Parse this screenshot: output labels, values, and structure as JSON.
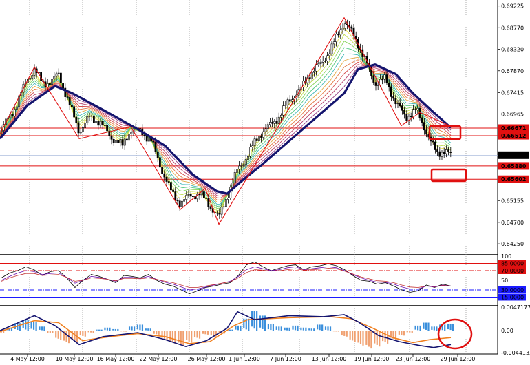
{
  "chart_data": [
    {
      "type": "candlestick",
      "panel": "price",
      "y_ticks": [
        "0.69225",
        "0.68770",
        "0.68320",
        "0.67870",
        "0.67415",
        "0.66965",
        "0.66512",
        "0.66105",
        "0.65580",
        "0.65155",
        "0.64700",
        "0.64250"
      ],
      "y_range": [
        0.6405,
        0.6935
      ],
      "price_tags": [
        {
          "label": "0.66671",
          "value": 0.66671,
          "color": "#e01010"
        },
        {
          "label": "0.66512",
          "value": 0.66512,
          "color": "#e01010"
        },
        {
          "label": "0.66105",
          "value": 0.66105,
          "color": "#000000"
        },
        {
          "label": "0.65880",
          "value": 0.6588,
          "color": "#e01010"
        },
        {
          "label": "0.65602",
          "value": 0.65602,
          "color": "#e01010"
        }
      ],
      "horizontal_lines": [
        0.66671,
        0.66512,
        0.6588,
        0.65602
      ],
      "zigzag": [
        [
          0,
          0.6655
        ],
        [
          50,
          0.6795
        ],
        [
          115,
          0.6645
        ],
        [
          190,
          0.667
        ],
        [
          262,
          0.6497
        ],
        [
          298,
          0.6541
        ],
        [
          318,
          0.6466
        ],
        [
          500,
          0.6898
        ],
        [
          583,
          0.6672
        ],
        [
          610,
          0.67
        ],
        [
          655,
          0.6671
        ]
      ],
      "close_path": [
        [
          0,
          0.666
        ],
        [
          20,
          0.6705
        ],
        [
          40,
          0.677
        ],
        [
          50,
          0.679
        ],
        [
          62,
          0.676
        ],
        [
          75,
          0.6765
        ],
        [
          85,
          0.678
        ],
        [
          95,
          0.674
        ],
        [
          105,
          0.67
        ],
        [
          115,
          0.666
        ],
        [
          130,
          0.669
        ],
        [
          145,
          0.668
        ],
        [
          160,
          0.665
        ],
        [
          178,
          0.663
        ],
        [
          190,
          0.6665
        ],
        [
          205,
          0.666
        ],
        [
          220,
          0.664
        ],
        [
          235,
          0.658
        ],
        [
          250,
          0.653
        ],
        [
          262,
          0.651
        ],
        [
          275,
          0.6525
        ],
        [
          290,
          0.653
        ],
        [
          305,
          0.6505
        ],
        [
          318,
          0.648
        ],
        [
          330,
          0.6525
        ],
        [
          345,
          0.658
        ],
        [
          360,
          0.661
        ],
        [
          375,
          0.665
        ],
        [
          390,
          0.667
        ],
        [
          405,
          0.669
        ],
        [
          420,
          0.6725
        ],
        [
          435,
          0.6745
        ],
        [
          450,
          0.678
        ],
        [
          465,
          0.68
        ],
        [
          480,
          0.683
        ],
        [
          500,
          0.689
        ],
        [
          510,
          0.687
        ],
        [
          520,
          0.6845
        ],
        [
          530,
          0.681
        ],
        [
          545,
          0.676
        ],
        [
          560,
          0.677
        ],
        [
          575,
          0.672
        ],
        [
          590,
          0.669
        ],
        [
          605,
          0.6705
        ],
        [
          615,
          0.6675
        ],
        [
          625,
          0.664
        ],
        [
          635,
          0.6615
        ],
        [
          645,
          0.662
        ],
        [
          655,
          0.661
        ]
      ],
      "ma_thick": [
        [
          0,
          0.6645
        ],
        [
          40,
          0.6715
        ],
        [
          80,
          0.6755
        ],
        [
          105,
          0.674
        ],
        [
          150,
          0.6705
        ],
        [
          200,
          0.6665
        ],
        [
          240,
          0.663
        ],
        [
          280,
          0.657
        ],
        [
          315,
          0.6535
        ],
        [
          330,
          0.653
        ],
        [
          350,
          0.6555
        ],
        [
          380,
          0.659
        ],
        [
          420,
          0.664
        ],
        [
          460,
          0.669
        ],
        [
          500,
          0.674
        ],
        [
          520,
          0.679
        ],
        [
          545,
          0.68
        ],
        [
          575,
          0.678
        ],
        [
          600,
          0.674
        ],
        [
          630,
          0.67
        ],
        [
          655,
          0.6668
        ]
      ],
      "x_ticks": [
        "4 May 12:00",
        "10 May 12:00",
        "16 May 12:00",
        "22 May 12:00",
        "26 May 12:00",
        "1 Jun 12:00",
        "7 Jun 12:00",
        "13 Jun 12:00",
        "19 Jun 12:00",
        "23 Jun 12:00",
        "29 Jun 12:00"
      ]
    },
    {
      "type": "line",
      "panel": "oscillator",
      "y_ticks": [
        "100",
        "85.0000",
        "70.0000",
        "50",
        "30.0000",
        "15.0000"
      ],
      "y_range": [
        0,
        100
      ],
      "levels": [
        {
          "value": 85,
          "color": "#e01010",
          "style": "solid"
        },
        {
          "value": 70,
          "color": "#e01010",
          "style": "dashdot"
        },
        {
          "value": 30,
          "color": "#1a1aff",
          "style": "dashdot"
        },
        {
          "value": 15,
          "color": "#1a1aff",
          "style": "solid"
        }
      ],
      "series": [
        {
          "color": "#000000",
          "values": [
            55,
            65,
            70,
            78,
            72,
            60,
            68,
            70,
            55,
            35,
            50,
            62,
            58,
            52,
            45,
            60,
            58,
            55,
            62,
            50,
            42,
            38,
            30,
            22,
            28,
            35,
            38,
            42,
            45,
            60,
            82,
            88,
            78,
            70,
            75,
            80,
            82,
            72,
            78,
            80,
            84,
            80,
            72,
            60,
            50,
            48,
            42,
            45,
            38,
            30,
            25,
            28,
            40,
            35,
            42,
            38
          ]
        },
        {
          "color": "#6a0dad",
          "values": [
            50,
            58,
            65,
            70,
            68,
            62,
            64,
            65,
            56,
            44,
            50,
            58,
            56,
            52,
            48,
            56,
            56,
            54,
            58,
            52,
            46,
            42,
            36,
            30,
            32,
            36,
            40,
            44,
            48,
            58,
            72,
            78,
            74,
            70,
            72,
            76,
            78,
            72,
            74,
            76,
            78,
            76,
            70,
            62,
            55,
            50,
            46,
            46,
            42,
            36,
            32,
            32,
            38,
            36,
            40,
            38
          ]
        },
        {
          "color": "#c03030",
          "values": [
            48,
            55,
            60,
            64,
            64,
            60,
            61,
            62,
            56,
            48,
            50,
            55,
            54,
            52,
            49,
            54,
            54,
            53,
            55,
            52,
            48,
            45,
            40,
            35,
            35,
            38,
            41,
            44,
            47,
            55,
            66,
            72,
            71,
            69,
            70,
            72,
            74,
            71,
            72,
            73,
            75,
            74,
            69,
            63,
            57,
            53,
            49,
            48,
            45,
            40,
            36,
            35,
            38,
            37,
            39,
            38
          ]
        }
      ]
    },
    {
      "type": "bar",
      "panel": "macd",
      "y_ticks": [
        "0.0047177",
        "0.00",
        "-0.0044133"
      ],
      "y_range": [
        -0.0044133,
        0.0047177
      ],
      "histogram": [
        -0.0005,
        0.0005,
        0.0015,
        0.0022,
        0.0018,
        0.0008,
        -0.0005,
        -0.0018,
        -0.0025,
        -0.0022,
        -0.0012,
        -0.0004,
        0.0002,
        0.0006,
        0.0003,
        -0.0002,
        0.0008,
        0.0012,
        0.0004,
        -0.0008,
        -0.0018,
        -0.0026,
        -0.003,
        -0.0024,
        -0.0016,
        -0.0008,
        -0.0012,
        -0.0006,
        0.0002,
        0.001,
        0.0024,
        0.004,
        0.003,
        0.0014,
        0.0008,
        0.0006,
        0.001,
        0.0006,
        0.0004,
        0.0012,
        0.0008,
        -0.0002,
        -0.0012,
        -0.0022,
        -0.003,
        -0.0036,
        -0.0032,
        -0.0026,
        -0.0018,
        -0.001,
        -0.0004,
        0.001,
        0.0016,
        0.0008,
        0.0012,
        0.0014
      ],
      "macd_line": [
        [
          0,
          0.0
        ],
        [
          50,
          0.003
        ],
        [
          80,
          0.001
        ],
        [
          115,
          -0.0028
        ],
        [
          150,
          -0.0012
        ],
        [
          200,
          -0.0004
        ],
        [
          240,
          -0.0018
        ],
        [
          270,
          -0.0032
        ],
        [
          300,
          -0.002
        ],
        [
          330,
          0.0005
        ],
        [
          345,
          0.0038
        ],
        [
          370,
          0.0022
        ],
        [
          420,
          0.003
        ],
        [
          470,
          0.0028
        ],
        [
          500,
          0.0032
        ],
        [
          520,
          0.0018
        ],
        [
          550,
          -0.001
        ],
        [
          580,
          -0.0022
        ],
        [
          610,
          -0.003
        ],
        [
          630,
          -0.0034
        ],
        [
          655,
          -0.0028
        ]
      ],
      "signal_line": [
        [
          0,
          -0.0002
        ],
        [
          50,
          0.002
        ],
        [
          85,
          0.0016
        ],
        [
          120,
          -0.002
        ],
        [
          160,
          -0.0012
        ],
        [
          200,
          -0.0006
        ],
        [
          240,
          -0.0012
        ],
        [
          275,
          -0.0026
        ],
        [
          305,
          -0.0022
        ],
        [
          340,
          0.001
        ],
        [
          360,
          0.0022
        ],
        [
          420,
          0.0026
        ],
        [
          480,
          0.0028
        ],
        [
          510,
          0.0024
        ],
        [
          540,
          0.0006
        ],
        [
          570,
          -0.0014
        ],
        [
          600,
          -0.0024
        ],
        [
          625,
          -0.0018
        ],
        [
          655,
          -0.0014
        ]
      ]
    }
  ]
}
